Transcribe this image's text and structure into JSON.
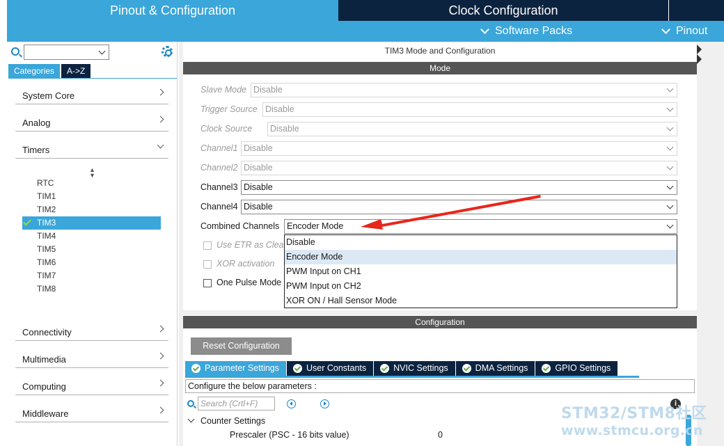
{
  "header": {
    "tabs": [
      {
        "label": "Pinout & Configuration",
        "active": true
      },
      {
        "label": "Clock Configuration",
        "active": false
      }
    ],
    "subbar": {
      "software_packs": "Software Packs",
      "pinout": "Pinout"
    }
  },
  "sidebar": {
    "search_value": "",
    "tabs": [
      "Categories",
      "A->Z"
    ],
    "categories": [
      {
        "label": "System Core"
      },
      {
        "label": "Analog"
      },
      {
        "label": "Timers",
        "expanded": true
      },
      {
        "label": "Connectivity"
      },
      {
        "label": "Multimedia"
      },
      {
        "label": "Computing"
      },
      {
        "label": "Middleware"
      }
    ],
    "timers": [
      "RTC",
      "TIM1",
      "TIM2",
      "TIM3",
      "TIM4",
      "TIM5",
      "TIM6",
      "TIM7",
      "TIM8"
    ],
    "selected_timer": "TIM3"
  },
  "mode_panel": {
    "title": "TIM3 Mode and Configuration",
    "mode_header": "Mode",
    "fields": [
      {
        "label": "Slave Mode",
        "value": "Disable",
        "enabled": false
      },
      {
        "label": "Trigger Source",
        "value": "Disable",
        "enabled": false
      },
      {
        "label": "Clock Source",
        "value": "Disable",
        "enabled": false
      },
      {
        "label": "Channel1",
        "value": "Disable",
        "enabled": false
      },
      {
        "label": "Channel2",
        "value": "Disable",
        "enabled": false
      },
      {
        "label": "Channel3",
        "value": "Disable",
        "enabled": true
      },
      {
        "label": "Channel4",
        "value": "Disable",
        "enabled": true
      },
      {
        "label": "Combined Channels",
        "value": "Encoder Mode",
        "enabled": true
      }
    ],
    "checkboxes": [
      {
        "label": "Use ETR as Clea",
        "enabled": false
      },
      {
        "label": "XOR activation",
        "enabled": false
      },
      {
        "label": "One Pulse Mode",
        "enabled": true
      }
    ],
    "dropdown_options": [
      "Disable",
      "Encoder Mode",
      "PWM Input on CH1",
      "PWM Input on CH2",
      "XOR ON / Hall Sensor Mode"
    ],
    "dropdown_highlighted": "Encoder Mode"
  },
  "config_panel": {
    "header": "Configuration",
    "reset_button": "Reset Configuration",
    "tabs": [
      {
        "label": "Parameter Settings",
        "active": true
      },
      {
        "label": "User Constants",
        "active": false
      },
      {
        "label": "NVIC Settings",
        "active": false
      },
      {
        "label": "DMA Settings",
        "active": false
      },
      {
        "label": "GPIO Settings",
        "active": false
      }
    ],
    "hint": "Configure the below parameters :",
    "search_placeholder": "Search (Crtl+F)",
    "group_label": "Counter Settings",
    "params": [
      {
        "name": "Prescaler (PSC - 16 bits value)",
        "value": "0"
      }
    ]
  },
  "watermark": {
    "line1": "STM32/STM8社区",
    "line2": "www.stmcu.org.cn"
  },
  "colors": {
    "accent_blue": "#3aa6da",
    "dark_navy": "#0c2340",
    "section_gray": "#555555",
    "annotation_red": "#e8261c"
  }
}
